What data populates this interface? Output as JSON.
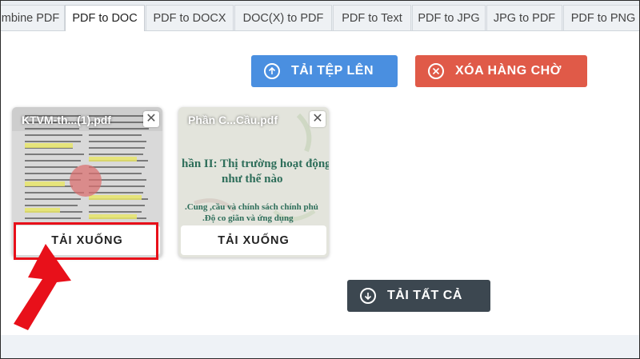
{
  "tabs": [
    {
      "label": "mbine PDF",
      "active": false
    },
    {
      "label": "PDF to DOC",
      "active": true
    },
    {
      "label": "PDF to DOCX",
      "active": false
    },
    {
      "label": "DOC(X) to PDF",
      "active": false
    },
    {
      "label": "PDF to Text",
      "active": false
    },
    {
      "label": "PDF to JPG",
      "active": false
    },
    {
      "label": "JPG to PDF",
      "active": false
    },
    {
      "label": "PDF to PNG",
      "active": false
    }
  ],
  "toolbar": {
    "upload_label": "TẢI TỆP LÊN",
    "clear_label": "XÓA HÀNG CHỜ",
    "download_all_label": "TẢI TẤT CẢ"
  },
  "files": [
    {
      "name": "KTVM-th...(1).pdf",
      "download_label": "TẢI XUỐNG"
    },
    {
      "name": "Phần C...Cầu.pdf",
      "download_label": "TẢI XUỐNG",
      "preview_lines": [
        "hần II: Thị trường hoạt động",
        "như thế nào",
        ".Cung ,cầu và chính sách chính phủ",
        ".Độ co giãn và ứng dụng"
      ]
    }
  ],
  "colors": {
    "upload": "#4a8fe0",
    "clear": "#e05a48",
    "download_all": "#3c4750",
    "highlight": "#e8101a"
  },
  "icons": {
    "upload": "arrow-up-circle-icon",
    "clear": "x-circle-icon",
    "download_all": "arrow-down-circle-icon",
    "close": "close-icon"
  }
}
